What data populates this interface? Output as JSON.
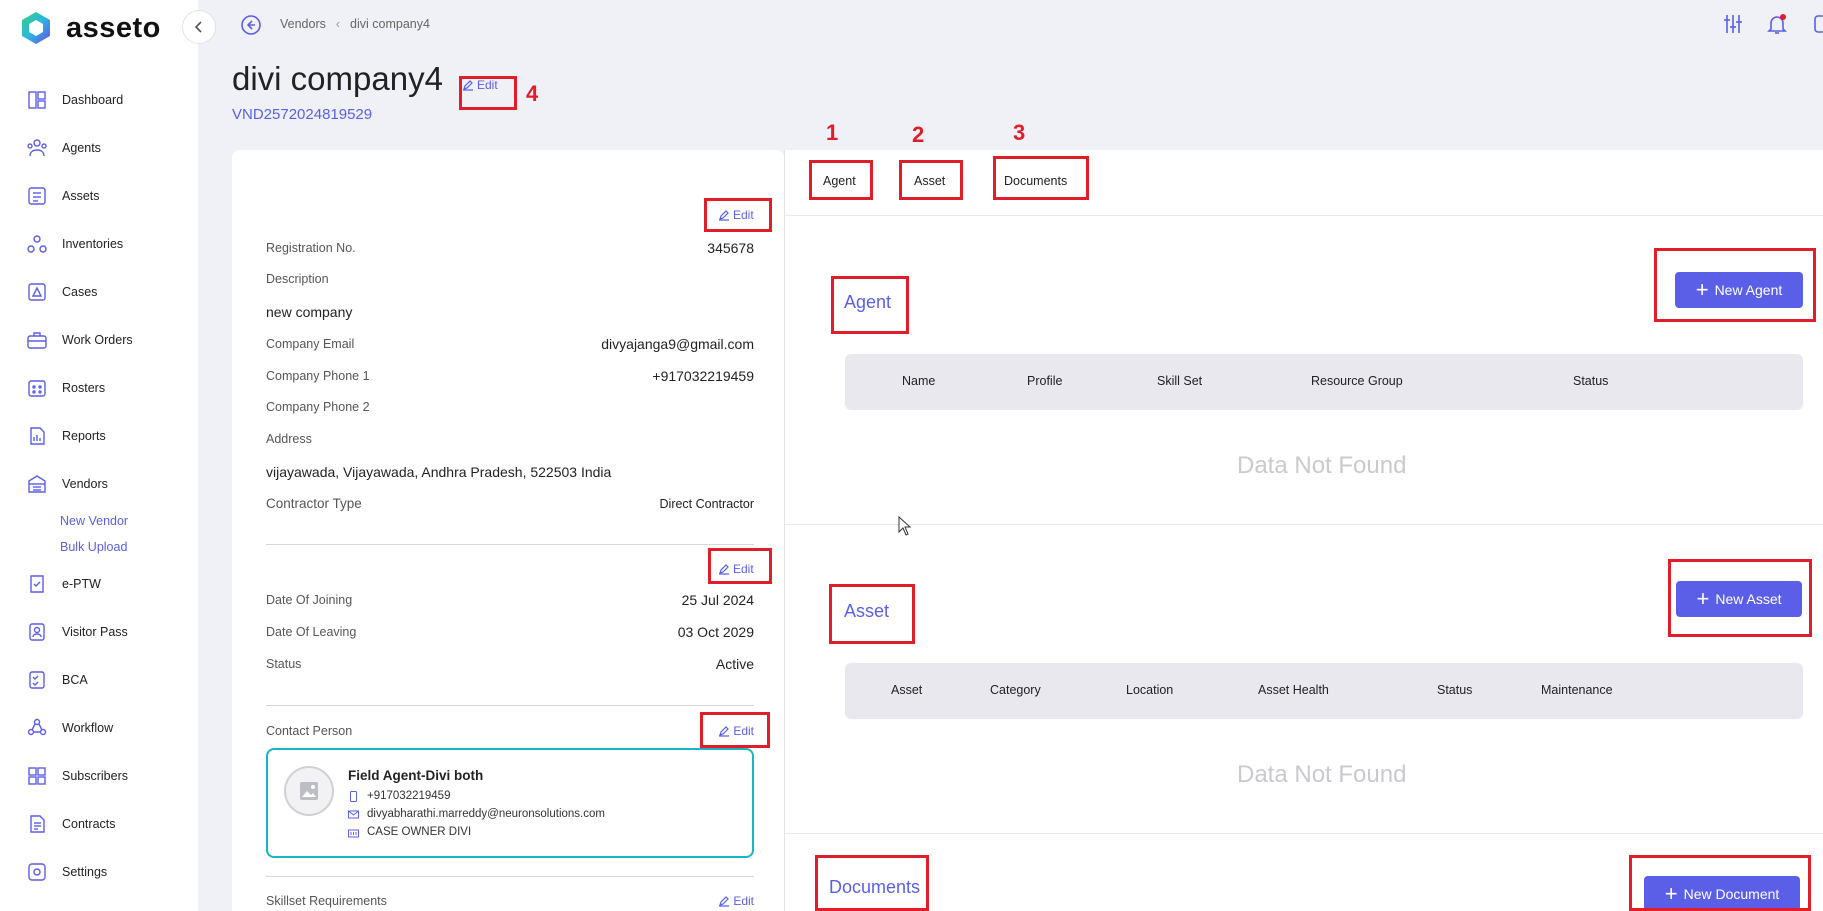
{
  "app": {
    "name": "asseto"
  },
  "sidebar": {
    "items": [
      {
        "label": "Dashboard",
        "icon": "dashboard-icon"
      },
      {
        "label": "Agents",
        "icon": "agents-icon"
      },
      {
        "label": "Assets",
        "icon": "assets-icon"
      },
      {
        "label": "Inventories",
        "icon": "inventories-icon"
      },
      {
        "label": "Cases",
        "icon": "cases-icon"
      },
      {
        "label": "Work Orders",
        "icon": "work-orders-icon"
      },
      {
        "label": "Rosters",
        "icon": "rosters-icon"
      },
      {
        "label": "Reports",
        "icon": "reports-icon"
      },
      {
        "label": "Vendors",
        "icon": "vendors-icon"
      },
      {
        "label": "e-PTW",
        "icon": "eptw-icon"
      },
      {
        "label": "Visitor Pass",
        "icon": "visitor-pass-icon"
      },
      {
        "label": "BCA",
        "icon": "bca-icon"
      },
      {
        "label": "Workflow",
        "icon": "workflow-icon"
      },
      {
        "label": "Subscribers",
        "icon": "subscribers-icon"
      },
      {
        "label": "Contracts",
        "icon": "contracts-icon"
      },
      {
        "label": "Settings",
        "icon": "settings-icon"
      }
    ],
    "vendor_sub": [
      "New Vendor",
      "Bulk Upload"
    ]
  },
  "breadcrumb": {
    "parent": "Vendors",
    "current": "divi company4"
  },
  "page": {
    "title": "divi company4",
    "vendor_id": "VND2572024819529",
    "edit_label": "Edit"
  },
  "annotations": {
    "n1": "1",
    "n2": "2",
    "n3": "3",
    "n4": "4"
  },
  "details": {
    "registration_label": "Registration No.",
    "registration_value": "345678",
    "description_label": "Description",
    "description_value": "new company",
    "email_label": "Company Email",
    "email_value": "divyajanga9@gmail.com",
    "phone1_label": "Company Phone 1",
    "phone1_value": "+917032219459",
    "phone2_label": "Company Phone 2",
    "address_label": "Address",
    "address_value": "vijayawada, Vijayawada, Andhra Pradesh, 522503 India",
    "contractor_label": "Contractor Type",
    "contractor_value": "Direct Contractor",
    "joining_label": "Date Of Joining",
    "joining_value": "25 Jul 2024",
    "leaving_label": "Date Of Leaving",
    "leaving_value": "03 Oct 2029",
    "status_label": "Status",
    "status_value": "Active",
    "contact_label": "Contact Person",
    "skillset_label": "Skillset Requirements"
  },
  "contact": {
    "name": "Field Agent-Divi both",
    "phone": "+917032219459",
    "email": "divyabharathi.marreddy@neuronsolutions.com",
    "role": "CASE OWNER DIVI"
  },
  "tabs": [
    "Agent",
    "Asset",
    "Documents"
  ],
  "agent_section": {
    "title": "Agent",
    "button": "New Agent",
    "columns": [
      "Name",
      "Profile",
      "Skill Set",
      "Resource Group",
      "Status"
    ],
    "empty": "Data Not Found"
  },
  "asset_section": {
    "title": "Asset",
    "button": "New Asset",
    "columns": [
      "Asset",
      "Category",
      "Location",
      "Asset Health",
      "Status",
      "Maintenance"
    ],
    "empty": "Data Not Found"
  },
  "documents_section": {
    "title": "Documents",
    "button": "New Document"
  },
  "colors": {
    "accent": "#5b5fe8",
    "annotation": "#e11d2a",
    "contact_border": "#19b6c6"
  }
}
